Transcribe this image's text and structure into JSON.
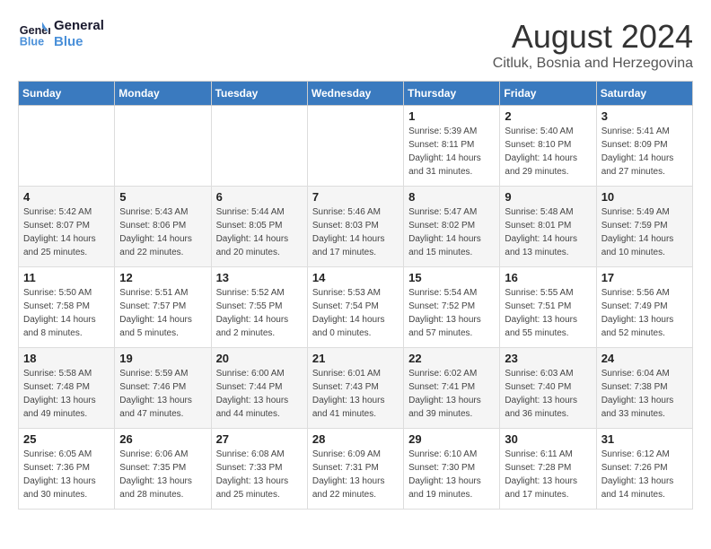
{
  "logo": {
    "line1": "General",
    "line2": "Blue"
  },
  "title": "August 2024",
  "subtitle": "Citluk, Bosnia and Herzegovina",
  "days_of_week": [
    "Sunday",
    "Monday",
    "Tuesday",
    "Wednesday",
    "Thursday",
    "Friday",
    "Saturday"
  ],
  "weeks": [
    [
      {
        "day": "",
        "info": ""
      },
      {
        "day": "",
        "info": ""
      },
      {
        "day": "",
        "info": ""
      },
      {
        "day": "",
        "info": ""
      },
      {
        "day": "1",
        "info": "Sunrise: 5:39 AM\nSunset: 8:11 PM\nDaylight: 14 hours\nand 31 minutes."
      },
      {
        "day": "2",
        "info": "Sunrise: 5:40 AM\nSunset: 8:10 PM\nDaylight: 14 hours\nand 29 minutes."
      },
      {
        "day": "3",
        "info": "Sunrise: 5:41 AM\nSunset: 8:09 PM\nDaylight: 14 hours\nand 27 minutes."
      }
    ],
    [
      {
        "day": "4",
        "info": "Sunrise: 5:42 AM\nSunset: 8:07 PM\nDaylight: 14 hours\nand 25 minutes."
      },
      {
        "day": "5",
        "info": "Sunrise: 5:43 AM\nSunset: 8:06 PM\nDaylight: 14 hours\nand 22 minutes."
      },
      {
        "day": "6",
        "info": "Sunrise: 5:44 AM\nSunset: 8:05 PM\nDaylight: 14 hours\nand 20 minutes."
      },
      {
        "day": "7",
        "info": "Sunrise: 5:46 AM\nSunset: 8:03 PM\nDaylight: 14 hours\nand 17 minutes."
      },
      {
        "day": "8",
        "info": "Sunrise: 5:47 AM\nSunset: 8:02 PM\nDaylight: 14 hours\nand 15 minutes."
      },
      {
        "day": "9",
        "info": "Sunrise: 5:48 AM\nSunset: 8:01 PM\nDaylight: 14 hours\nand 13 minutes."
      },
      {
        "day": "10",
        "info": "Sunrise: 5:49 AM\nSunset: 7:59 PM\nDaylight: 14 hours\nand 10 minutes."
      }
    ],
    [
      {
        "day": "11",
        "info": "Sunrise: 5:50 AM\nSunset: 7:58 PM\nDaylight: 14 hours\nand 8 minutes."
      },
      {
        "day": "12",
        "info": "Sunrise: 5:51 AM\nSunset: 7:57 PM\nDaylight: 14 hours\nand 5 minutes."
      },
      {
        "day": "13",
        "info": "Sunrise: 5:52 AM\nSunset: 7:55 PM\nDaylight: 14 hours\nand 2 minutes."
      },
      {
        "day": "14",
        "info": "Sunrise: 5:53 AM\nSunset: 7:54 PM\nDaylight: 14 hours\nand 0 minutes."
      },
      {
        "day": "15",
        "info": "Sunrise: 5:54 AM\nSunset: 7:52 PM\nDaylight: 13 hours\nand 57 minutes."
      },
      {
        "day": "16",
        "info": "Sunrise: 5:55 AM\nSunset: 7:51 PM\nDaylight: 13 hours\nand 55 minutes."
      },
      {
        "day": "17",
        "info": "Sunrise: 5:56 AM\nSunset: 7:49 PM\nDaylight: 13 hours\nand 52 minutes."
      }
    ],
    [
      {
        "day": "18",
        "info": "Sunrise: 5:58 AM\nSunset: 7:48 PM\nDaylight: 13 hours\nand 49 minutes."
      },
      {
        "day": "19",
        "info": "Sunrise: 5:59 AM\nSunset: 7:46 PM\nDaylight: 13 hours\nand 47 minutes."
      },
      {
        "day": "20",
        "info": "Sunrise: 6:00 AM\nSunset: 7:44 PM\nDaylight: 13 hours\nand 44 minutes."
      },
      {
        "day": "21",
        "info": "Sunrise: 6:01 AM\nSunset: 7:43 PM\nDaylight: 13 hours\nand 41 minutes."
      },
      {
        "day": "22",
        "info": "Sunrise: 6:02 AM\nSunset: 7:41 PM\nDaylight: 13 hours\nand 39 minutes."
      },
      {
        "day": "23",
        "info": "Sunrise: 6:03 AM\nSunset: 7:40 PM\nDaylight: 13 hours\nand 36 minutes."
      },
      {
        "day": "24",
        "info": "Sunrise: 6:04 AM\nSunset: 7:38 PM\nDaylight: 13 hours\nand 33 minutes."
      }
    ],
    [
      {
        "day": "25",
        "info": "Sunrise: 6:05 AM\nSunset: 7:36 PM\nDaylight: 13 hours\nand 30 minutes."
      },
      {
        "day": "26",
        "info": "Sunrise: 6:06 AM\nSunset: 7:35 PM\nDaylight: 13 hours\nand 28 minutes."
      },
      {
        "day": "27",
        "info": "Sunrise: 6:08 AM\nSunset: 7:33 PM\nDaylight: 13 hours\nand 25 minutes."
      },
      {
        "day": "28",
        "info": "Sunrise: 6:09 AM\nSunset: 7:31 PM\nDaylight: 13 hours\nand 22 minutes."
      },
      {
        "day": "29",
        "info": "Sunrise: 6:10 AM\nSunset: 7:30 PM\nDaylight: 13 hours\nand 19 minutes."
      },
      {
        "day": "30",
        "info": "Sunrise: 6:11 AM\nSunset: 7:28 PM\nDaylight: 13 hours\nand 17 minutes."
      },
      {
        "day": "31",
        "info": "Sunrise: 6:12 AM\nSunset: 7:26 PM\nDaylight: 13 hours\nand 14 minutes."
      }
    ]
  ]
}
